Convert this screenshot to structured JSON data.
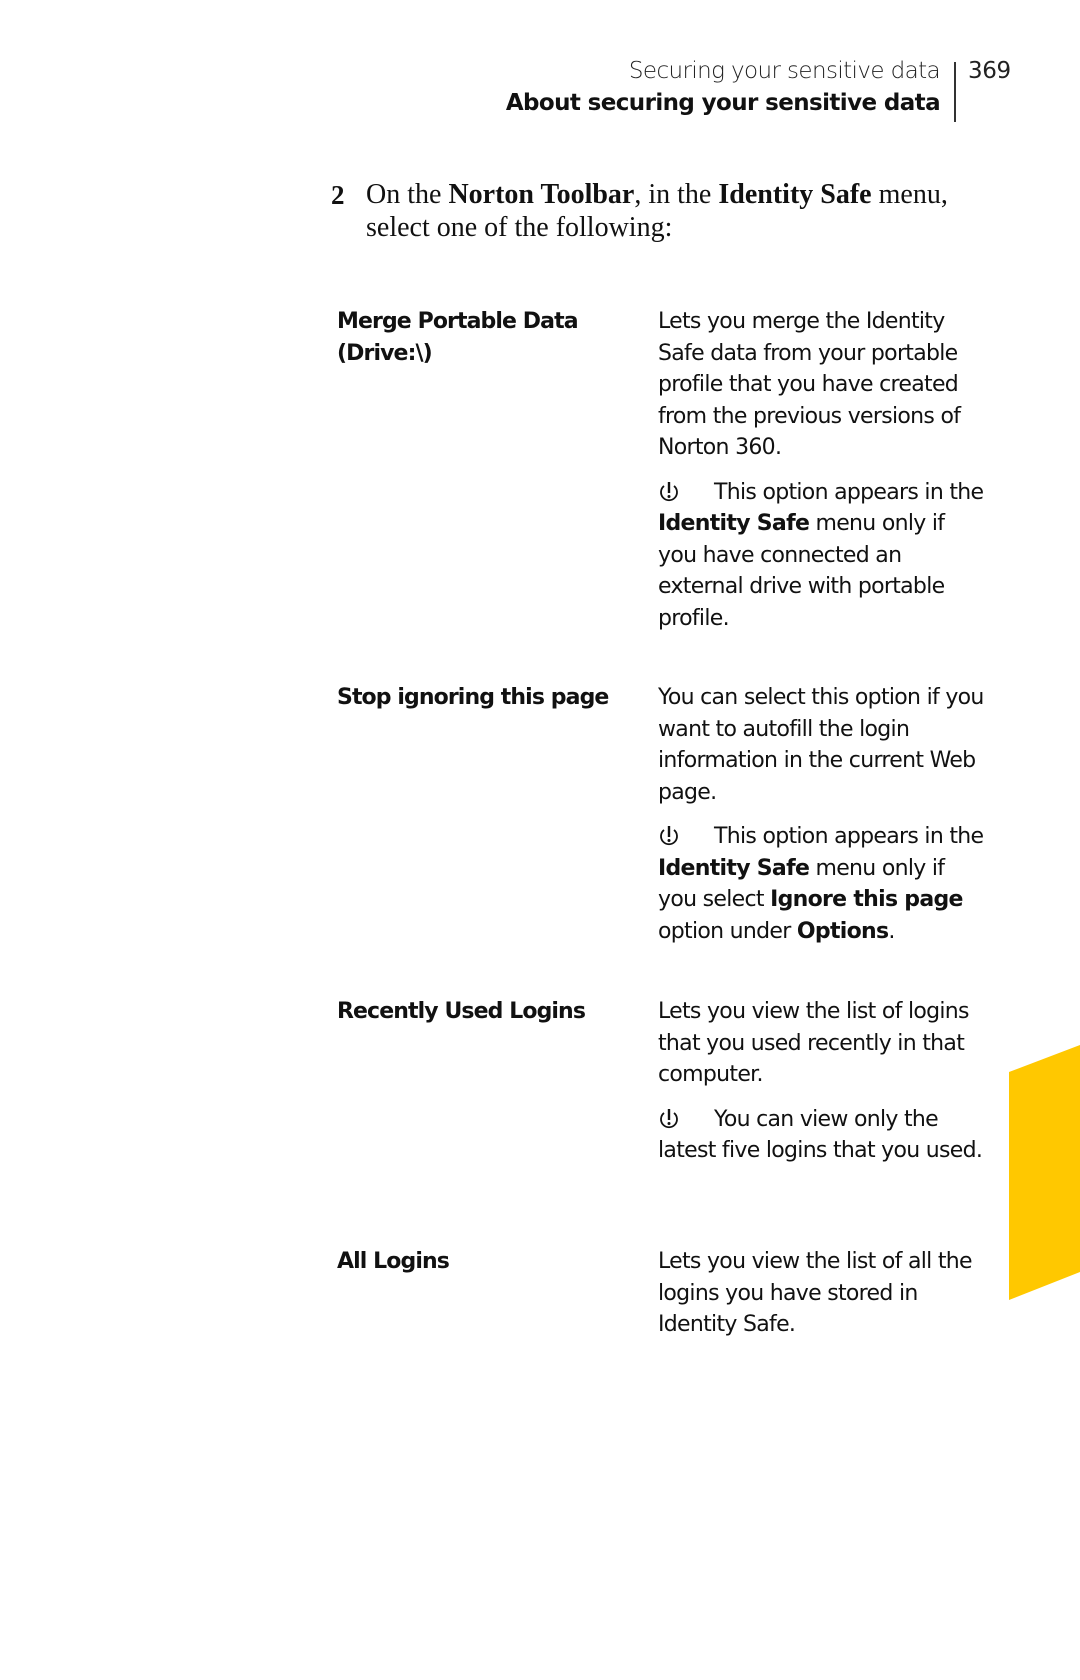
{
  "header": {
    "chapter_title": "Securing your sensitive data",
    "section_title": "About securing your sensitive data",
    "page_number": "369"
  },
  "step": {
    "number": "2",
    "text_parts": {
      "p1": "On the ",
      "b1": "Norton Toolbar",
      "p2": ", in the ",
      "b2": "Identity Safe",
      "p3": " menu, select one of the following:"
    }
  },
  "options": [
    {
      "term": "Merge Portable Data (Drive:\\)",
      "description": "Lets you merge the Identity Safe data from your portable profile that you have created from the previous versions of Norton 360.",
      "note": {
        "icon": "warning-icon",
        "p1": "This option appears in the ",
        "b1": "Identity Safe",
        "p2": " menu only if you have connected an external drive with portable profile."
      }
    },
    {
      "term": "Stop ignoring this page",
      "description": "You can select this option if you want to autofill the login information in the current Web page.",
      "note": {
        "icon": "warning-icon",
        "p1": "This option appears in the ",
        "b1": "Identity Safe",
        "p2": " menu only if you select ",
        "b2": "Ignore this page",
        "p3": " option under ",
        "b3": "Options",
        "p4": "."
      }
    },
    {
      "term": "Recently Used Logins",
      "description": "Lets you view the list of logins that you used recently in that computer.",
      "note": {
        "icon": "warning-icon",
        "p1": "You can view only the latest five logins that you used."
      }
    },
    {
      "term": "All Logins",
      "description": "Lets you view the list of all the logins you have stored in Identity Safe."
    }
  ],
  "colors": {
    "thumb_tab": "#FFC800",
    "text": "#111111"
  }
}
